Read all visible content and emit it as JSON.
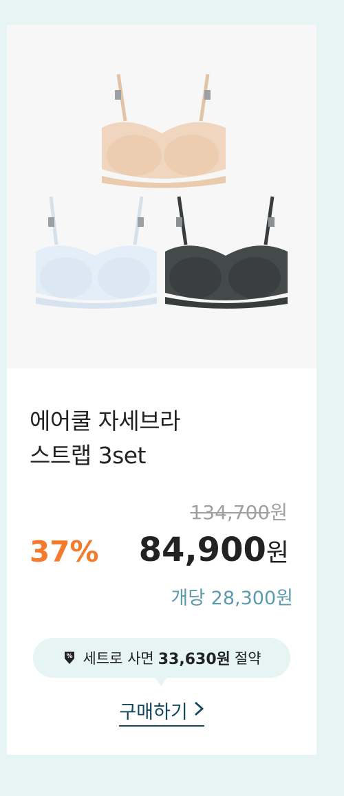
{
  "product": {
    "title_line1": "에어쿨 자세브라",
    "title_line2": "스트랩 3set",
    "original_price": "134,700",
    "original_unit": "원",
    "discount": "37%",
    "price": "84,900",
    "price_unit": "원",
    "per_unit": "개당 28,300원",
    "colors": [
      "#f0d2b6",
      "#e3eef8",
      "#3d4142"
    ]
  },
  "savings": {
    "prefix": "세트로 사면",
    "amount": "33,630원",
    "suffix": "절약",
    "icon": "discount-tag-icon"
  },
  "buy": {
    "label": "구매하기",
    "icon": "chevron-right-icon"
  },
  "colors": {
    "accent": "#f47a2d",
    "link": "#12485c",
    "muted_blue": "#5d9aad",
    "bg": "#e6f4f4"
  }
}
